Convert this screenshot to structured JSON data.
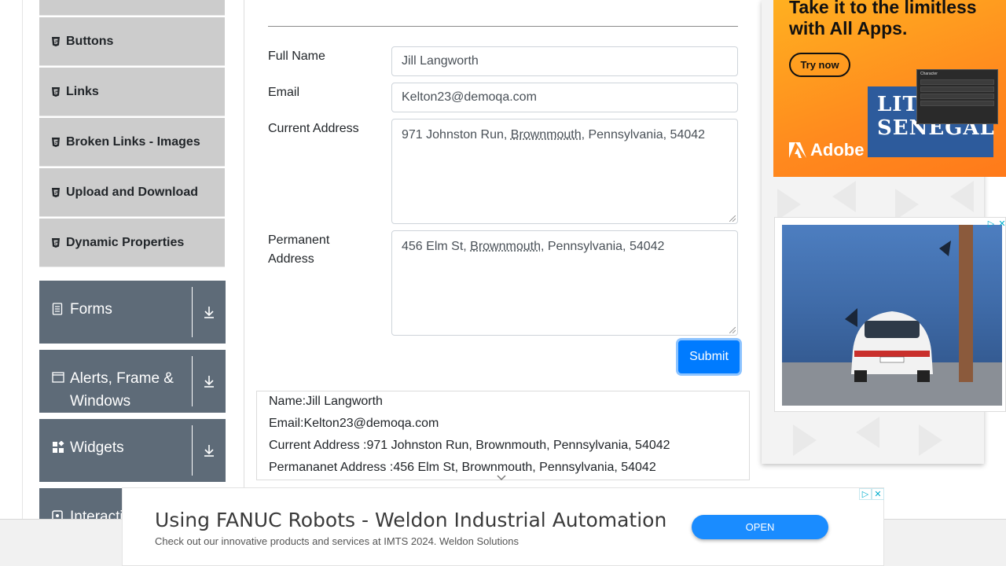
{
  "sidebar": {
    "sub_items": [
      {
        "label": ""
      },
      {
        "label": "Buttons"
      },
      {
        "label": "Links"
      },
      {
        "label": "Broken Links - Images"
      },
      {
        "label": "Upload and Download"
      },
      {
        "label": "Dynamic Properties"
      }
    ],
    "groups": [
      {
        "label": "Forms",
        "icon": "document-icon"
      },
      {
        "label": "Alerts, Frame & Windows",
        "icon": "window-icon"
      },
      {
        "label": "Widgets",
        "icon": "widgets-icon"
      },
      {
        "label": "Interactions",
        "icon": "interactions-icon"
      }
    ]
  },
  "form": {
    "full_name_label": "Full Name",
    "full_name_value": "Jill Langworth",
    "email_label": "Email",
    "email_value": "Kelton23@demoqa.com",
    "current_address_label": "Current Address",
    "current_address": {
      "pre": "971 Johnston Run, ",
      "underlined": "Brownmouth",
      "post": ", Pennsylvania, 54042"
    },
    "permanent_address_label_line1": "Permanent",
    "permanent_address_label_line2": "Address",
    "permanent_address": {
      "pre": "456 Elm St, ",
      "underlined": "Brownmouth",
      "post": ", Pennsylvania, 54042"
    },
    "submit_label": "Submit"
  },
  "output": {
    "name": "Name:Jill Langworth",
    "email": "Email:Kelton23@demoqa.com",
    "current_address": "Current Address :971 Johnston Run, Brownmouth, Pennsylvania, 54042",
    "permanent_address": "Permananet Address :456 Elm St, Brownmouth, Pennsylvania, 54042"
  },
  "ads": {
    "adobe": {
      "headline_line1": "Take it to the limitless",
      "headline_line2": "with All Apps.",
      "cta": "Try now",
      "brand": "Adobe",
      "poster_line1": "LITTLE",
      "poster_line2": "SENEGAL",
      "panel_title": "Character"
    },
    "car": {
      "plate": "MLB 808"
    },
    "banner": {
      "title": "Using FANUC Robots - Weldon Industrial Automation",
      "description": "Check out our innovative products and services at IMTS 2024. Weldon Solutions",
      "cta": "OPEN"
    }
  },
  "colors": {
    "primary": "#007bff",
    "sidebar_group": "#5e6b78",
    "sidebar_sub": "#cccccc",
    "adobe_orange": "#ff8a1e"
  }
}
